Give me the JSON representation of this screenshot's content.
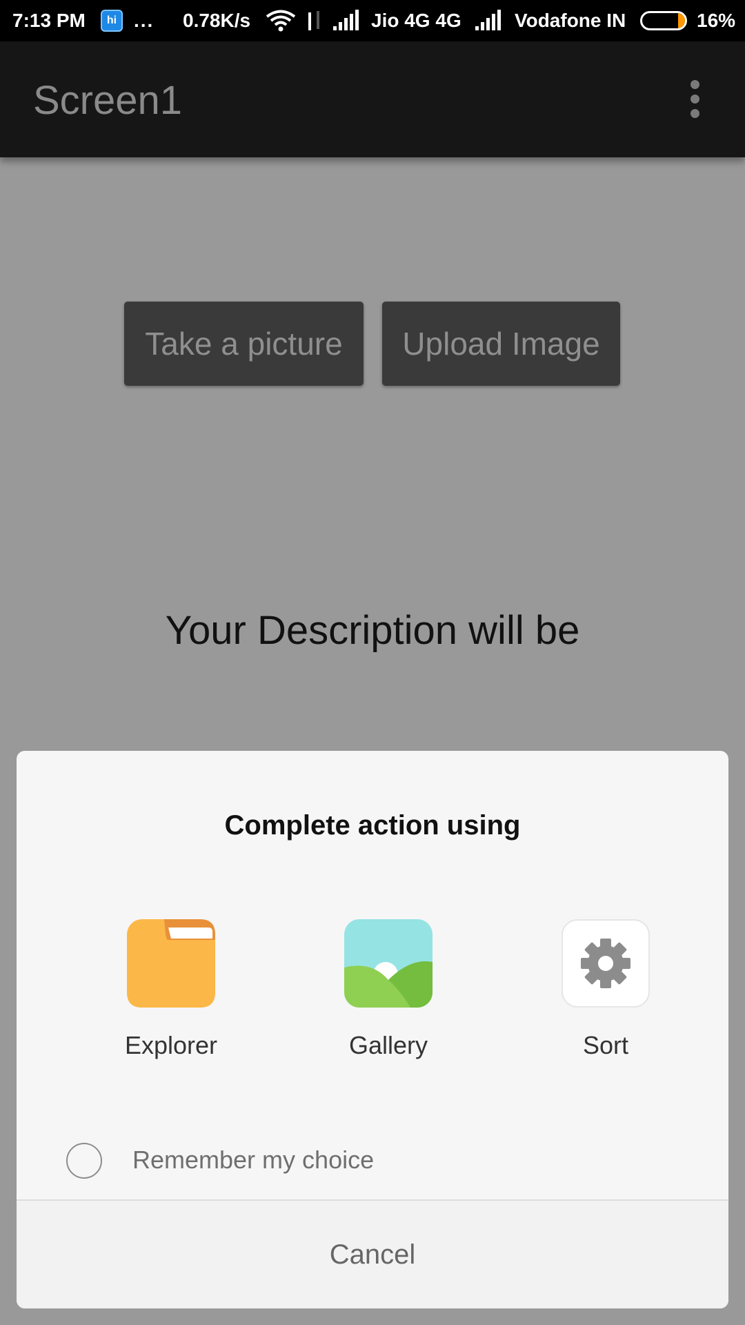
{
  "status_bar": {
    "time": "7:13 PM",
    "notification_badge": "hi",
    "more_indicator": "...",
    "net_speed": "0.78K/s",
    "carrier_1": "Jio 4G  4G",
    "carrier_2": "Vodafone IN",
    "battery_percent": "16%",
    "battery_level": 0.16,
    "battery_color": "#ff9800"
  },
  "app_bar": {
    "title": "Screen1",
    "menu_icon": "overflow-menu-icon"
  },
  "main": {
    "take_picture_label": "Take a picture",
    "upload_image_label": "Upload Image",
    "description_text": "Your Description will be"
  },
  "dialog": {
    "title": "Complete action using",
    "apps": [
      {
        "label": "Explorer",
        "icon": "folder-icon",
        "color": "#fbb848"
      },
      {
        "label": "Gallery",
        "icon": "gallery-icon",
        "color": "#7ec64a"
      },
      {
        "label": "Sort",
        "icon": "gear-icon",
        "color": "#8c8c8c"
      }
    ],
    "remember_label": "Remember my choice",
    "cancel_label": "Cancel"
  }
}
